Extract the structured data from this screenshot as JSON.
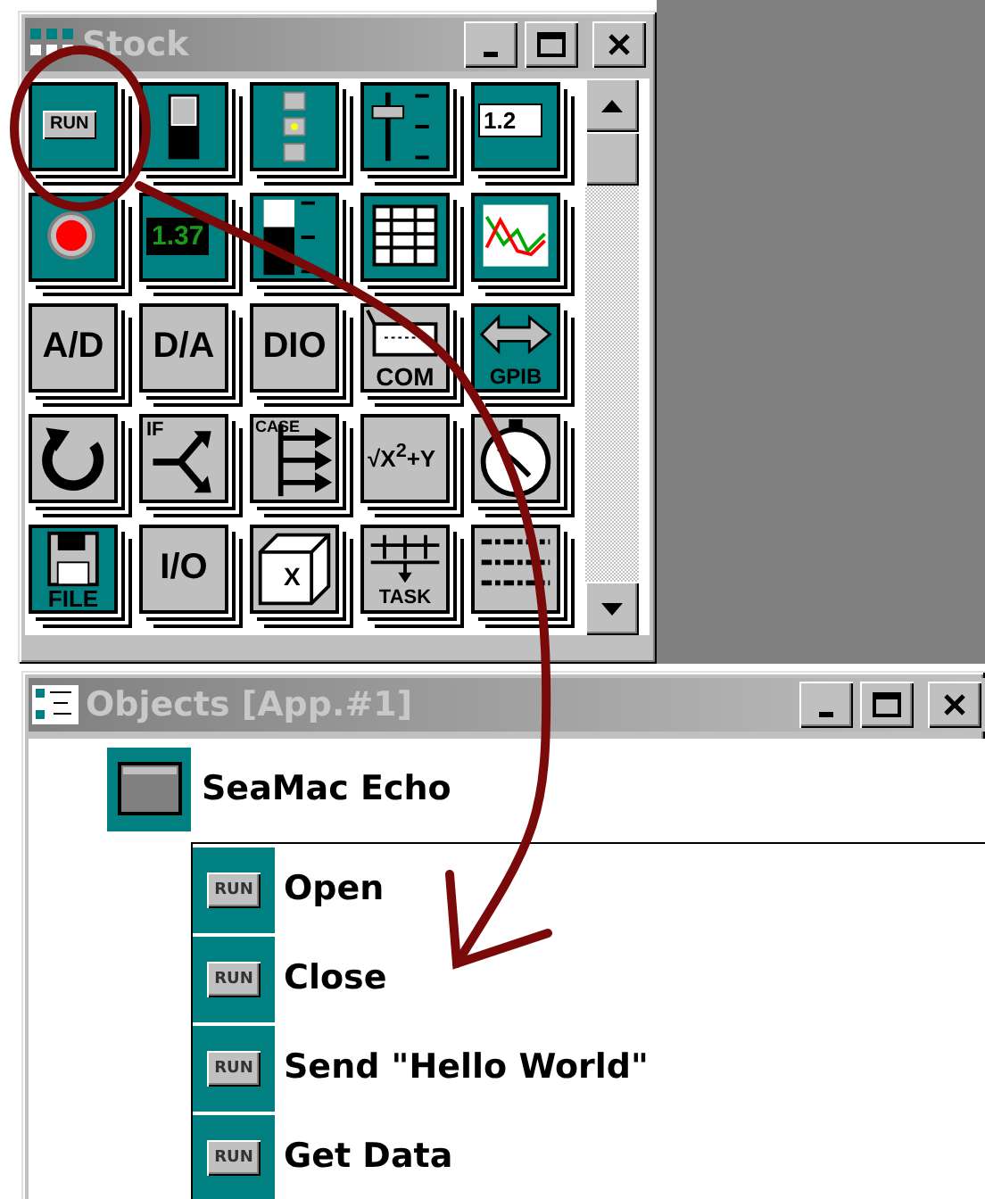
{
  "stock_window": {
    "title": "Stock",
    "tiles": [
      {
        "kind": "run",
        "color": "#008080",
        "label": "RUN"
      },
      {
        "kind": "switch",
        "color": "#008080"
      },
      {
        "kind": "lights",
        "color": "#008080"
      },
      {
        "kind": "slider",
        "color": "#008080"
      },
      {
        "kind": "entry",
        "color": "#008080",
        "label": "1.2"
      },
      {
        "kind": "led",
        "color": "#008080"
      },
      {
        "kind": "display",
        "color": "#008080",
        "label": "1.37"
      },
      {
        "kind": "meter",
        "color": "#008080"
      },
      {
        "kind": "grid",
        "color": "#008080"
      },
      {
        "kind": "chart",
        "color": "#008080"
      },
      {
        "kind": "text",
        "color": "#c0c0c0",
        "label": "A/D"
      },
      {
        "kind": "text",
        "color": "#c0c0c0",
        "label": "D/A"
      },
      {
        "kind": "text",
        "color": "#c0c0c0",
        "label": "DIO"
      },
      {
        "kind": "port",
        "color": "#c0c0c0",
        "label": "COM"
      },
      {
        "kind": "arrows",
        "color": "#008080",
        "label": "GPIB"
      },
      {
        "kind": "loop",
        "color": "#c0c0c0"
      },
      {
        "kind": "branch",
        "color": "#c0c0c0",
        "label": "IF"
      },
      {
        "kind": "case",
        "color": "#c0c0c0",
        "label": "CASE"
      },
      {
        "kind": "formula",
        "color": "#c0c0c0",
        "label": "√X$^{2}$+Y"
      },
      {
        "kind": "timer",
        "color": "#c0c0c0"
      },
      {
        "kind": "disk",
        "color": "#008080",
        "label": "FILE"
      },
      {
        "kind": "text",
        "color": "#c0c0c0",
        "label": "I/O"
      },
      {
        "kind": "cube",
        "color": "#c0c0c0",
        "label": "X"
      },
      {
        "kind": "task",
        "color": "#c0c0c0",
        "label": "TASK"
      },
      {
        "kind": "list",
        "color": "#c0c0c0"
      }
    ]
  },
  "objects_window": {
    "title": "Objects [App.#1]",
    "root": {
      "label": "SeaMac Echo",
      "children": [
        {
          "label": "Open",
          "badge": "RUN"
        },
        {
          "label": "Close",
          "badge": "RUN"
        },
        {
          "label": "Send \"Hello World\"",
          "badge": "RUN"
        },
        {
          "label": "Get Data",
          "badge": "RUN"
        }
      ]
    }
  }
}
